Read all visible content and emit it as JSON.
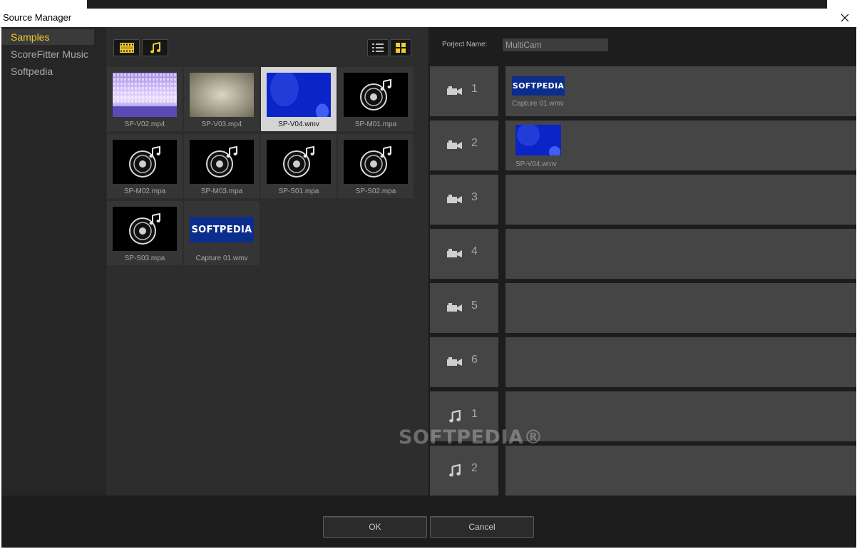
{
  "window": {
    "title": "Source Manager"
  },
  "sidebar": {
    "items": [
      {
        "label": "Samples",
        "active": true
      },
      {
        "label": "ScoreFitter Music",
        "active": false
      },
      {
        "label": "Softpedia",
        "active": false
      }
    ]
  },
  "toolbar": {
    "filters": [
      {
        "icon": "film-strip-icon",
        "active": true
      },
      {
        "icon": "music-note-icon",
        "active": true
      }
    ],
    "views": [
      {
        "icon": "list-view-icon",
        "active": false
      },
      {
        "icon": "grid-view-icon",
        "active": true
      }
    ]
  },
  "library": {
    "items": [
      {
        "name": "SP-V02.mp4",
        "type": "video"
      },
      {
        "name": "SP-V03.mp4",
        "type": "video"
      },
      {
        "name": "SP-V04.wmv",
        "type": "video",
        "selected": true
      },
      {
        "name": "SP-M01.mpa",
        "type": "audio"
      },
      {
        "name": "SP-M02.mpa",
        "type": "audio"
      },
      {
        "name": "SP-M03.mpa",
        "type": "audio"
      },
      {
        "name": "SP-S01.mpa",
        "type": "audio"
      },
      {
        "name": "SP-S02.mpa",
        "type": "audio"
      },
      {
        "name": "SP-S03.mpa",
        "type": "audio"
      },
      {
        "name": "Capture 01.wmv",
        "type": "video",
        "logo_text": "SOFTPEDIA"
      }
    ]
  },
  "project": {
    "name_label": "Porject Name:",
    "name_value": "MultiCam"
  },
  "tracks": [
    {
      "kind": "camera",
      "number": "1",
      "clip": {
        "label": "Capture 01.wmv",
        "logo_text": "SOFTPEDIA"
      }
    },
    {
      "kind": "camera",
      "number": "2",
      "clip": {
        "label": "SP-V04.wmv"
      }
    },
    {
      "kind": "camera",
      "number": "3"
    },
    {
      "kind": "camera",
      "number": "4"
    },
    {
      "kind": "camera",
      "number": "5"
    },
    {
      "kind": "camera",
      "number": "6"
    },
    {
      "kind": "audio",
      "number": "1"
    },
    {
      "kind": "audio",
      "number": "2"
    }
  ],
  "watermark": "SOFTPEDIA®",
  "footer": {
    "ok_label": "OK",
    "cancel_label": "Cancel"
  },
  "colors": {
    "accent": "#f2cc30",
    "panel": "#2d2d2d",
    "track": "#454545",
    "background": "#1d1d1d"
  }
}
